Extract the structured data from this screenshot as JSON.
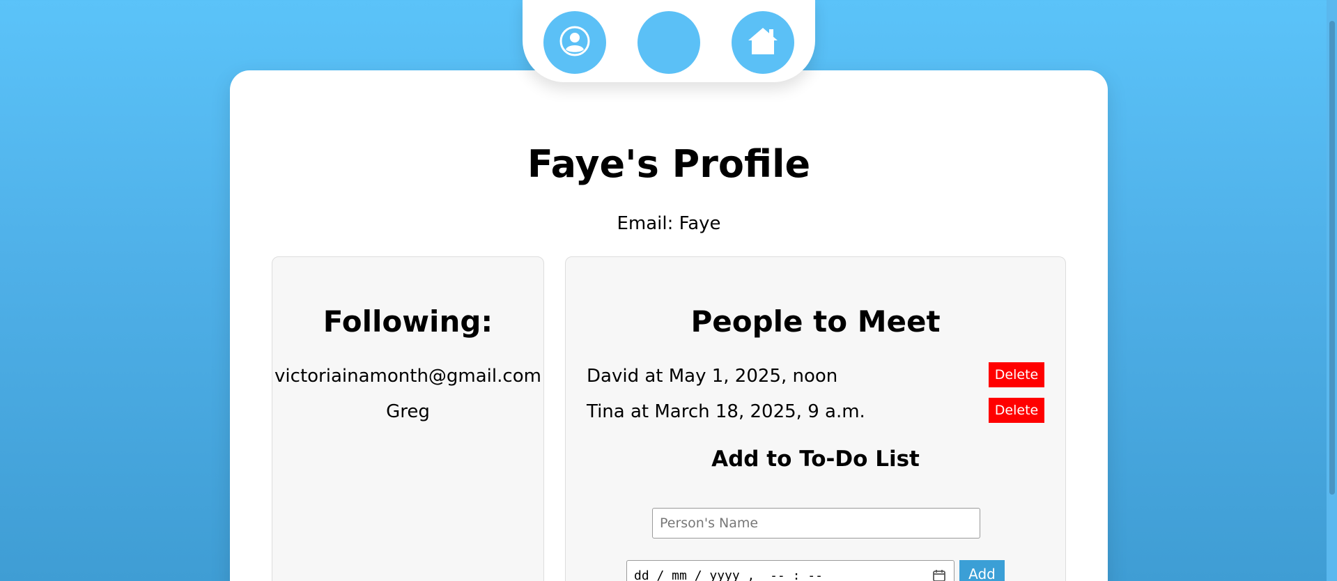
{
  "nav": {
    "buttons": [
      {
        "name": "profile",
        "icon": "user-circle-icon"
      },
      {
        "name": "blank",
        "icon": ""
      },
      {
        "name": "home",
        "icon": "home-icon"
      }
    ],
    "accent_color": "#5bc0f6"
  },
  "profile": {
    "title": "Faye's Profile",
    "email_line": "Email: Faye"
  },
  "following": {
    "heading": "Following:",
    "items": [
      "victoriainamonth@gmail.com",
      "Greg"
    ]
  },
  "meet": {
    "heading": "People to Meet",
    "items": [
      {
        "text": "David at May 1, 2025, noon",
        "delete_label": "Delete"
      },
      {
        "text": "Tina at March 18, 2025, 9 a.m.",
        "delete_label": "Delete"
      }
    ],
    "delete_color": "#ff0000"
  },
  "todo": {
    "heading": "Add to To-Do List",
    "name_placeholder": "Person's Name",
    "name_value": "",
    "datetime_placeholder": "dd / mm / yyyy ,  -- : --",
    "add_label": "Add",
    "add_color": "#3b9fd6"
  }
}
